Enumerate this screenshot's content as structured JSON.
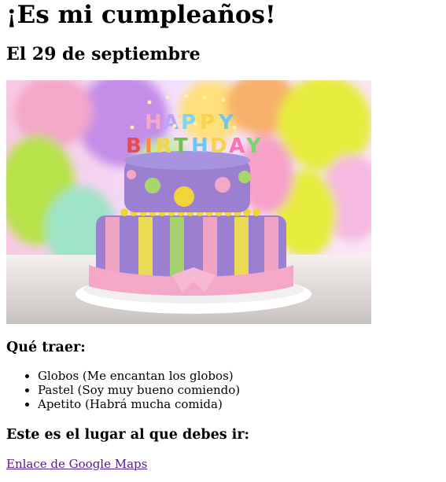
{
  "page": {
    "title": "¡Es mi cumpleaños!",
    "date_heading": "El 29 de septiembre",
    "image_caption_letters": "HAPPY BIRTHDAY",
    "bring_heading": "Qué traer:",
    "bring_items": [
      "Globos (Me encantan los globos)",
      "Pastel (Soy muy bueno comiendo)",
      "Apetito (Habrá mucha comida)"
    ],
    "place_heading": "Este es el lugar al que debes ir:",
    "map_link_label": "Enlace de Google Maps"
  },
  "colors": {
    "link_visited": "#551a8b",
    "cake_purple": "#9b7fd1",
    "cake_pink": "#f4a7c6",
    "balloon_yellow": "#e6ec3a",
    "balloon_purple": "#c38de8"
  }
}
